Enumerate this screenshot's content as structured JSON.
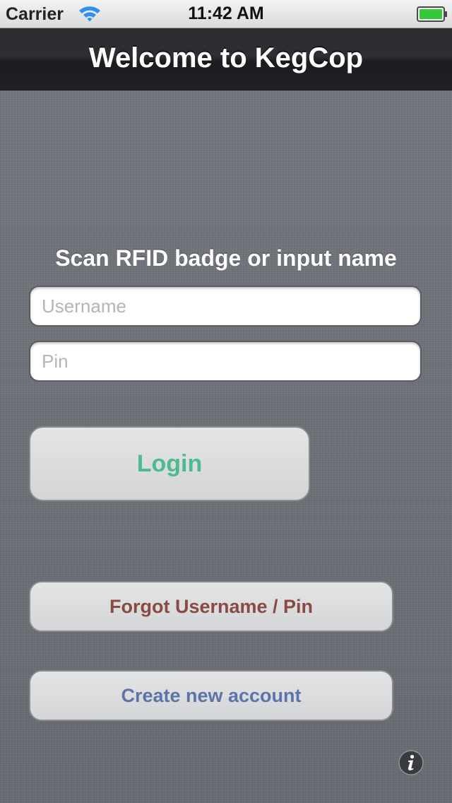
{
  "status_bar": {
    "carrier": "Carrier",
    "time": "11:42 AM",
    "wifi_icon": "wifi-icon",
    "battery_icon": "battery-icon",
    "battery_color": "#34c83a"
  },
  "nav_bar": {
    "title": "Welcome to KegCop"
  },
  "login_form": {
    "prompt": "Scan RFID badge or input name",
    "username": {
      "placeholder": "Username",
      "value": ""
    },
    "pin": {
      "placeholder": "Pin",
      "value": ""
    },
    "login_label": "Login",
    "login_color": "#4dbb8e"
  },
  "account_actions": {
    "forgot_label": "Forgot Username / Pin",
    "forgot_color": "#8a4a44",
    "create_label": "Create new account",
    "create_color": "#5c74a8"
  },
  "footer": {
    "info_icon": "info-icon"
  }
}
